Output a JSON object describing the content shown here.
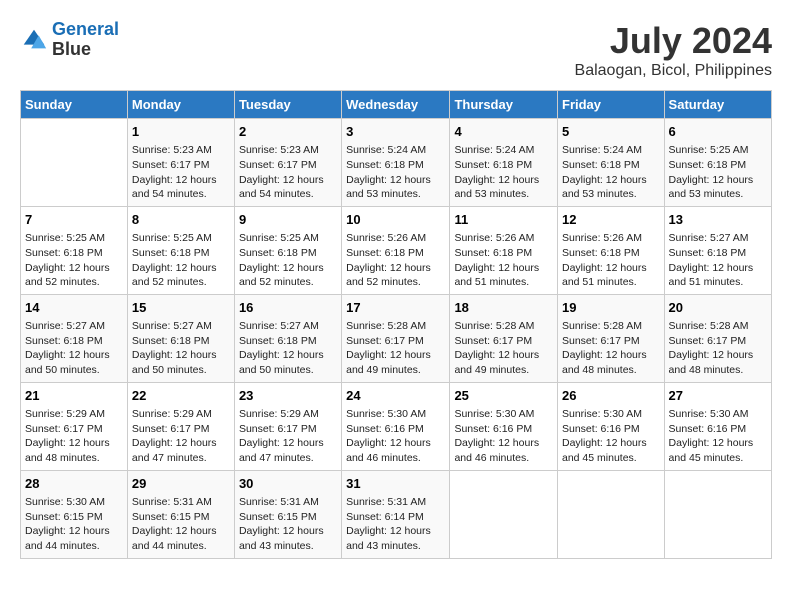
{
  "header": {
    "logo_line1": "General",
    "logo_line2": "Blue",
    "title": "July 2024",
    "subtitle": "Balaogan, Bicol, Philippines"
  },
  "columns": [
    "Sunday",
    "Monday",
    "Tuesday",
    "Wednesday",
    "Thursday",
    "Friday",
    "Saturday"
  ],
  "weeks": [
    [
      {
        "day": "",
        "sunrise": "",
        "sunset": "",
        "daylight": ""
      },
      {
        "day": "1",
        "sunrise": "Sunrise: 5:23 AM",
        "sunset": "Sunset: 6:17 PM",
        "daylight": "Daylight: 12 hours and 54 minutes."
      },
      {
        "day": "2",
        "sunrise": "Sunrise: 5:23 AM",
        "sunset": "Sunset: 6:17 PM",
        "daylight": "Daylight: 12 hours and 54 minutes."
      },
      {
        "day": "3",
        "sunrise": "Sunrise: 5:24 AM",
        "sunset": "Sunset: 6:18 PM",
        "daylight": "Daylight: 12 hours and 53 minutes."
      },
      {
        "day": "4",
        "sunrise": "Sunrise: 5:24 AM",
        "sunset": "Sunset: 6:18 PM",
        "daylight": "Daylight: 12 hours and 53 minutes."
      },
      {
        "day": "5",
        "sunrise": "Sunrise: 5:24 AM",
        "sunset": "Sunset: 6:18 PM",
        "daylight": "Daylight: 12 hours and 53 minutes."
      },
      {
        "day": "6",
        "sunrise": "Sunrise: 5:25 AM",
        "sunset": "Sunset: 6:18 PM",
        "daylight": "Daylight: 12 hours and 53 minutes."
      }
    ],
    [
      {
        "day": "7",
        "sunrise": "Sunrise: 5:25 AM",
        "sunset": "Sunset: 6:18 PM",
        "daylight": "Daylight: 12 hours and 52 minutes."
      },
      {
        "day": "8",
        "sunrise": "Sunrise: 5:25 AM",
        "sunset": "Sunset: 6:18 PM",
        "daylight": "Daylight: 12 hours and 52 minutes."
      },
      {
        "day": "9",
        "sunrise": "Sunrise: 5:25 AM",
        "sunset": "Sunset: 6:18 PM",
        "daylight": "Daylight: 12 hours and 52 minutes."
      },
      {
        "day": "10",
        "sunrise": "Sunrise: 5:26 AM",
        "sunset": "Sunset: 6:18 PM",
        "daylight": "Daylight: 12 hours and 52 minutes."
      },
      {
        "day": "11",
        "sunrise": "Sunrise: 5:26 AM",
        "sunset": "Sunset: 6:18 PM",
        "daylight": "Daylight: 12 hours and 51 minutes."
      },
      {
        "day": "12",
        "sunrise": "Sunrise: 5:26 AM",
        "sunset": "Sunset: 6:18 PM",
        "daylight": "Daylight: 12 hours and 51 minutes."
      },
      {
        "day": "13",
        "sunrise": "Sunrise: 5:27 AM",
        "sunset": "Sunset: 6:18 PM",
        "daylight": "Daylight: 12 hours and 51 minutes."
      }
    ],
    [
      {
        "day": "14",
        "sunrise": "Sunrise: 5:27 AM",
        "sunset": "Sunset: 6:18 PM",
        "daylight": "Daylight: 12 hours and 50 minutes."
      },
      {
        "day": "15",
        "sunrise": "Sunrise: 5:27 AM",
        "sunset": "Sunset: 6:18 PM",
        "daylight": "Daylight: 12 hours and 50 minutes."
      },
      {
        "day": "16",
        "sunrise": "Sunrise: 5:27 AM",
        "sunset": "Sunset: 6:18 PM",
        "daylight": "Daylight: 12 hours and 50 minutes."
      },
      {
        "day": "17",
        "sunrise": "Sunrise: 5:28 AM",
        "sunset": "Sunset: 6:17 PM",
        "daylight": "Daylight: 12 hours and 49 minutes."
      },
      {
        "day": "18",
        "sunrise": "Sunrise: 5:28 AM",
        "sunset": "Sunset: 6:17 PM",
        "daylight": "Daylight: 12 hours and 49 minutes."
      },
      {
        "day": "19",
        "sunrise": "Sunrise: 5:28 AM",
        "sunset": "Sunset: 6:17 PM",
        "daylight": "Daylight: 12 hours and 48 minutes."
      },
      {
        "day": "20",
        "sunrise": "Sunrise: 5:28 AM",
        "sunset": "Sunset: 6:17 PM",
        "daylight": "Daylight: 12 hours and 48 minutes."
      }
    ],
    [
      {
        "day": "21",
        "sunrise": "Sunrise: 5:29 AM",
        "sunset": "Sunset: 6:17 PM",
        "daylight": "Daylight: 12 hours and 48 minutes."
      },
      {
        "day": "22",
        "sunrise": "Sunrise: 5:29 AM",
        "sunset": "Sunset: 6:17 PM",
        "daylight": "Daylight: 12 hours and 47 minutes."
      },
      {
        "day": "23",
        "sunrise": "Sunrise: 5:29 AM",
        "sunset": "Sunset: 6:17 PM",
        "daylight": "Daylight: 12 hours and 47 minutes."
      },
      {
        "day": "24",
        "sunrise": "Sunrise: 5:30 AM",
        "sunset": "Sunset: 6:16 PM",
        "daylight": "Daylight: 12 hours and 46 minutes."
      },
      {
        "day": "25",
        "sunrise": "Sunrise: 5:30 AM",
        "sunset": "Sunset: 6:16 PM",
        "daylight": "Daylight: 12 hours and 46 minutes."
      },
      {
        "day": "26",
        "sunrise": "Sunrise: 5:30 AM",
        "sunset": "Sunset: 6:16 PM",
        "daylight": "Daylight: 12 hours and 45 minutes."
      },
      {
        "day": "27",
        "sunrise": "Sunrise: 5:30 AM",
        "sunset": "Sunset: 6:16 PM",
        "daylight": "Daylight: 12 hours and 45 minutes."
      }
    ],
    [
      {
        "day": "28",
        "sunrise": "Sunrise: 5:30 AM",
        "sunset": "Sunset: 6:15 PM",
        "daylight": "Daylight: 12 hours and 44 minutes."
      },
      {
        "day": "29",
        "sunrise": "Sunrise: 5:31 AM",
        "sunset": "Sunset: 6:15 PM",
        "daylight": "Daylight: 12 hours and 44 minutes."
      },
      {
        "day": "30",
        "sunrise": "Sunrise: 5:31 AM",
        "sunset": "Sunset: 6:15 PM",
        "daylight": "Daylight: 12 hours and 43 minutes."
      },
      {
        "day": "31",
        "sunrise": "Sunrise: 5:31 AM",
        "sunset": "Sunset: 6:14 PM",
        "daylight": "Daylight: 12 hours and 43 minutes."
      },
      {
        "day": "",
        "sunrise": "",
        "sunset": "",
        "daylight": ""
      },
      {
        "day": "",
        "sunrise": "",
        "sunset": "",
        "daylight": ""
      },
      {
        "day": "",
        "sunrise": "",
        "sunset": "",
        "daylight": ""
      }
    ]
  ]
}
